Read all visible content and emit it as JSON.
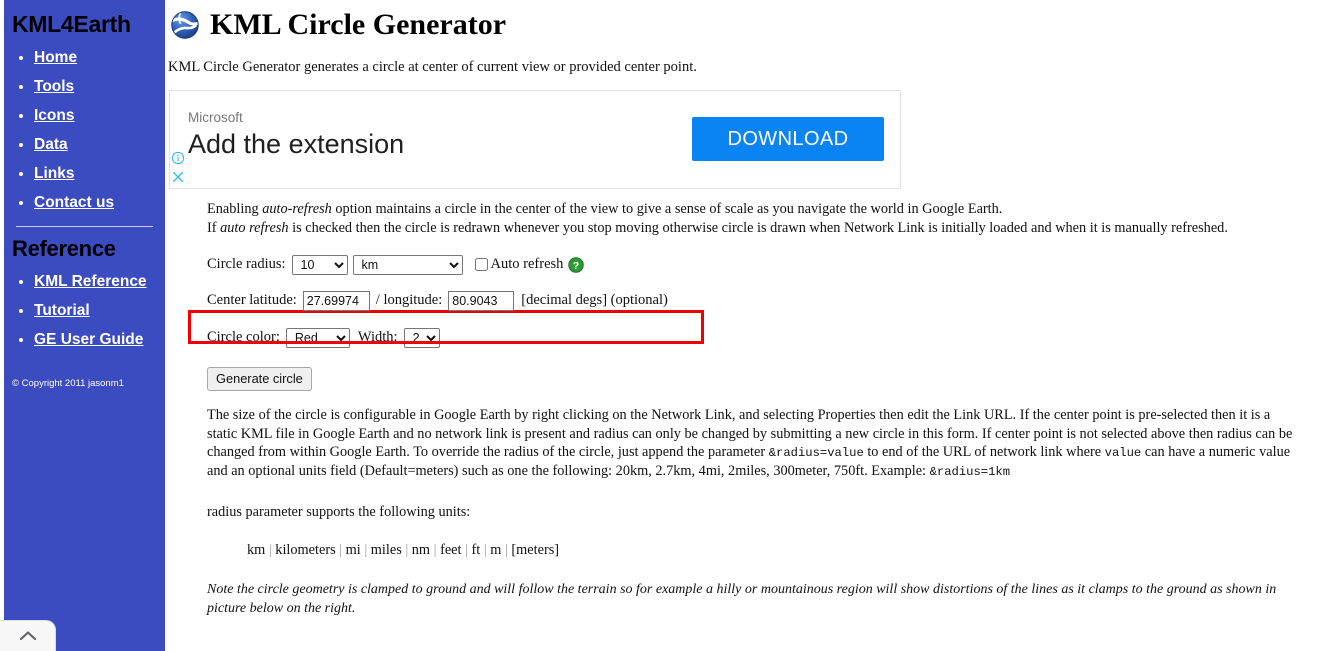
{
  "sidebar": {
    "brand": "KML4Earth",
    "nav": [
      {
        "label": "Home"
      },
      {
        "label": "Tools"
      },
      {
        "label": "Icons"
      },
      {
        "label": "Data"
      },
      {
        "label": "Links"
      },
      {
        "label": "Contact us"
      }
    ],
    "reference_heading": "Reference",
    "reference_links": [
      {
        "label": "KML Reference"
      },
      {
        "label": "Tutorial"
      },
      {
        "label": "GE User Guide"
      }
    ],
    "copyright": "© Copyright 2011 jasonm1"
  },
  "header": {
    "icon": "google-earth-globe-icon",
    "title": "KML Circle Generator",
    "intro": "KML Circle Generator generates a circle at center of current view or provided center point."
  },
  "ad": {
    "brand": "Microsoft",
    "headline": "Add the extension",
    "button_label": "DOWNLOAD",
    "info_icon": "ad-info-icon",
    "close_icon": "ad-close-icon",
    "button_color": "#0a84f2"
  },
  "description": {
    "line1_a": "Enabling ",
    "line1_em": "auto-refresh",
    "line1_b": " option maintains a circle in the center of the view to give a sense of scale as you navigate the world in Google Earth.",
    "line2_a": "If ",
    "line2_em": "auto refresh",
    "line2_b": " is checked then the circle is redrawn whenever you stop moving otherwise circle is drawn when Network Link is initially loaded and when it is manually refreshed."
  },
  "form": {
    "radius_label": "Circle radius:",
    "radius_value": "10",
    "radius_options": [
      "10"
    ],
    "unit_value": "km",
    "unit_options": [
      "km"
    ],
    "auto_refresh_label": "Auto refresh",
    "auto_refresh_checked": false,
    "help_icon": "help-question-icon",
    "latitude_label": "Center latitude:",
    "latitude_value": "27.69974",
    "separator": "/ longitude:",
    "longitude_value": "80.9043",
    "coords_suffix": "[decimal degs] (optional)",
    "color_label": "Circle color:",
    "color_value": "Red",
    "color_options": [
      "Red"
    ],
    "width_label": "Width:",
    "width_value": "2",
    "width_options": [
      "2"
    ],
    "generate_label": "Generate circle",
    "highlight_color": "#ee0000"
  },
  "info": {
    "text_a": "The size of the circle is configurable in Google Earth by right clicking on the Network Link, and selecting Properties then edit the Link URL. If the center point is pre-selected then it is a static KML file in Google Earth and no network link is present and radius can only be changed by submitting a new circle in this form. If center point is not selected above then radius can be changed from within Google Earth. To override the radius of the circle, just append the parameter ",
    "code_a": "&radius=value",
    "text_b": " to end of the URL of network link where ",
    "code_b": "value",
    "text_c": " can have a numeric value and an optional units field (Default=meters) such as one the following: 20km, 2.7km, 4mi, 2miles, 300meter, 750ft. Example: ",
    "code_c": "&radius=1km"
  },
  "units": {
    "intro": "radius parameter supports the following units:",
    "list": [
      "km",
      "kilometers",
      "mi",
      "miles",
      "nm",
      "feet",
      "ft",
      "m",
      "[meters]"
    ]
  },
  "note": "Note the circle geometry is clamped to ground and will follow the terrain so for example a hilly or mountainous region will show distortions of the lines as it clamps to the ground as shown in picture below on the right.",
  "scroll_top": {
    "icon": "chevron-up-icon"
  }
}
